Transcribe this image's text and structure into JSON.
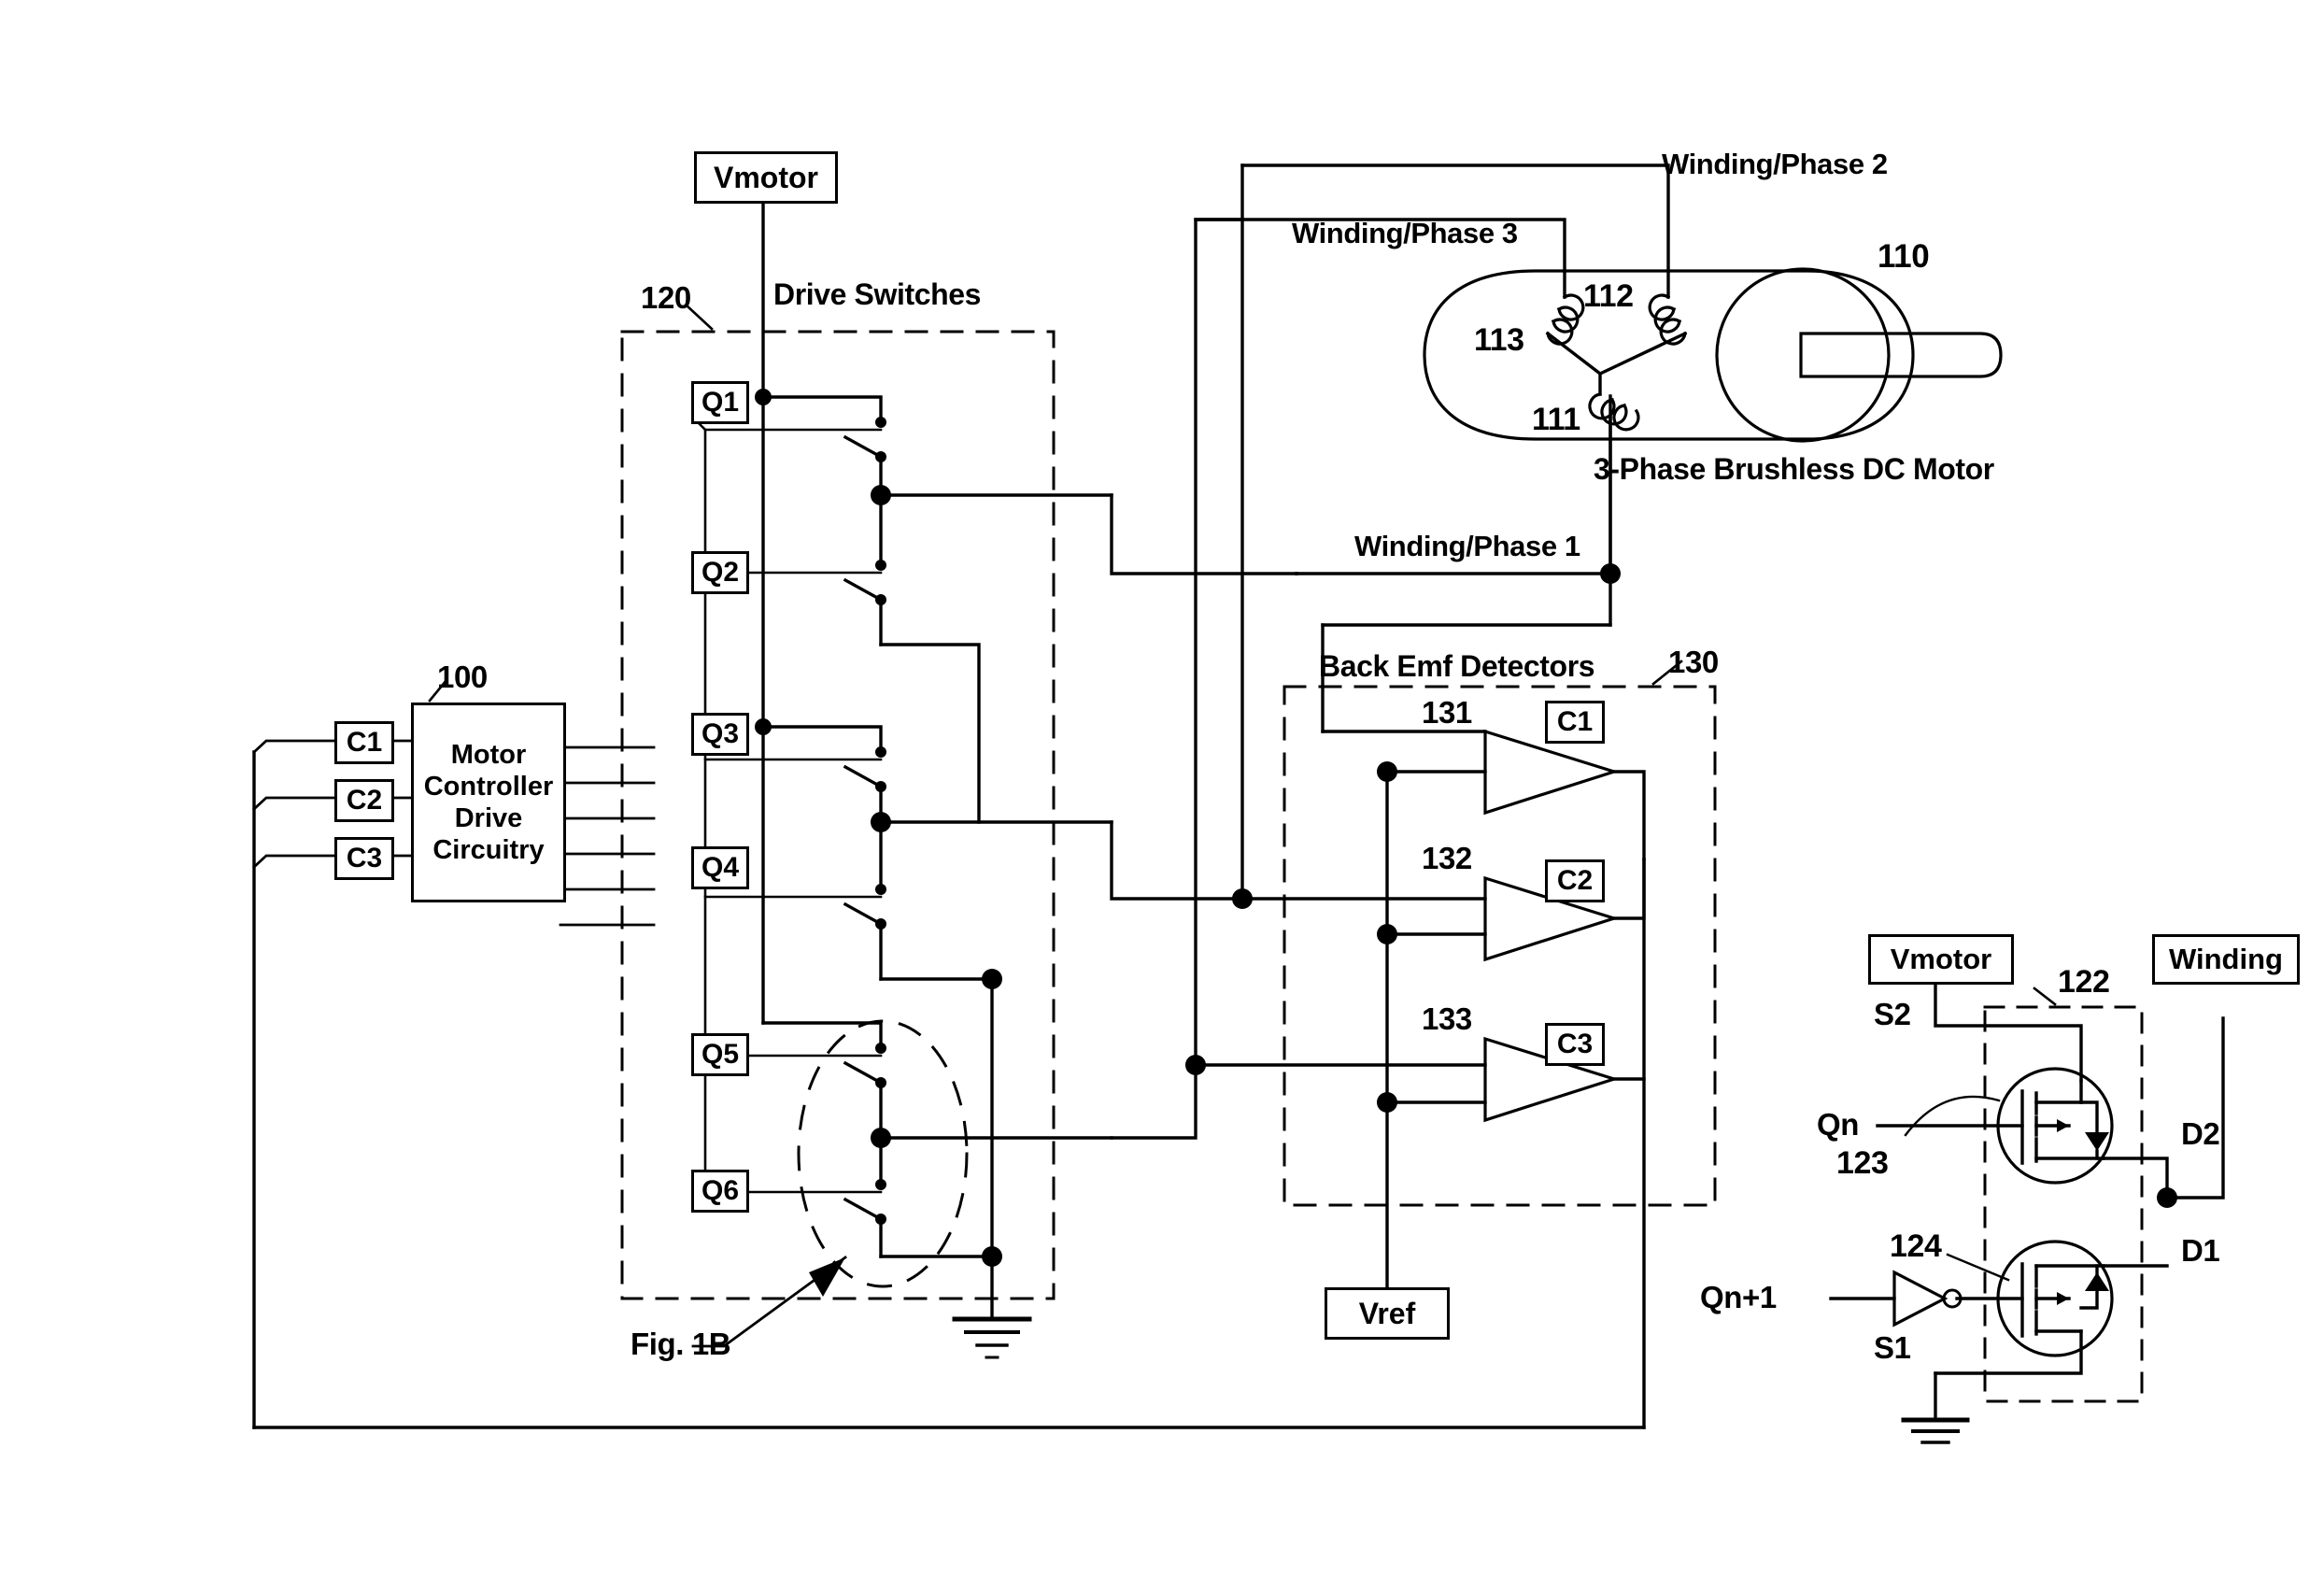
{
  "figure": {
    "title": "Fig. 1B",
    "motor_title": "3-Phase Brushless DC Motor",
    "drive_switches_title": "Drive Switches",
    "back_emf_title": "Back Emf Detectors"
  },
  "supplies": {
    "vmotor_main": "Vmotor",
    "vmotor_inset": "Vmotor",
    "vref": "Vref",
    "winding_inset": "Winding"
  },
  "controller": {
    "line1": "Motor",
    "line2": "Controller",
    "line3": "Drive",
    "line4": "Circuitry",
    "ref": "100"
  },
  "reference_numerals": {
    "motor": "110",
    "winding_111": "111",
    "winding_112": "112",
    "winding_113": "113",
    "drive_switches": "120",
    "inset_block": "122",
    "mosfet_high": "123",
    "mosfet_low": "124",
    "back_emf_block": "130",
    "comparator_1": "131",
    "comparator_2": "132",
    "comparator_3": "133"
  },
  "switches": [
    {
      "id": "Q1"
    },
    {
      "id": "Q2"
    },
    {
      "id": "Q3"
    },
    {
      "id": "Q4"
    },
    {
      "id": "Q5"
    },
    {
      "id": "Q6"
    }
  ],
  "controller_inputs": [
    {
      "id": "C1"
    },
    {
      "id": "C2"
    },
    {
      "id": "C3"
    }
  ],
  "comparator_outputs": [
    {
      "id": "C1"
    },
    {
      "id": "C2"
    },
    {
      "id": "C3"
    }
  ],
  "windings": [
    {
      "label": "Winding/Phase 1"
    },
    {
      "label": "Winding/Phase 2"
    },
    {
      "label": "Winding/Phase 3"
    }
  ],
  "inset_nodes": {
    "s2": "S2",
    "s1": "S1",
    "d2": "D2",
    "d1": "D1",
    "qn": "Qn",
    "qn1": "Qn+1"
  }
}
